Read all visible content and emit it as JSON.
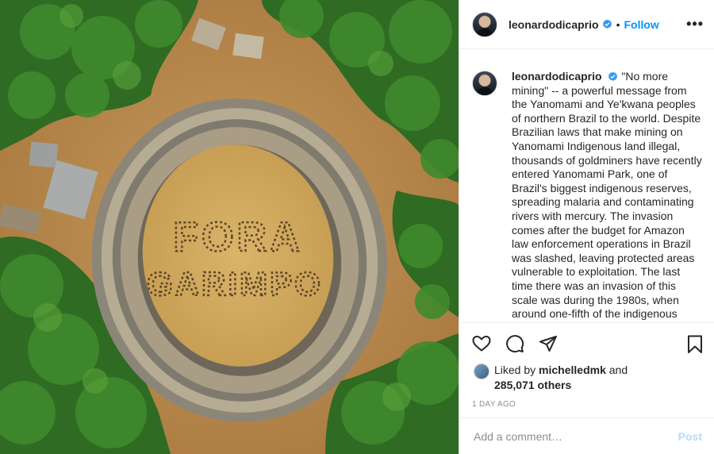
{
  "post": {
    "username": "leonardodicaprio",
    "follow_label": "Follow",
    "more_label": "•••",
    "separator": "•",
    "caption_username": "leonardodicaprio",
    "caption_text": "\"No more mining\" -- a powerful message from the Yanomami and Ye'kwana peoples of northern Brazil to the world. Despite Brazilian laws that make mining on Yanomami Indigenous land illegal, thousands of goldminers have recently entered Yanomami Park, one of Brazil's biggest indigenous reserves, spreading malaria and contaminating rivers with mercury. The invasion comes after the budget for Amazon law enforcement operations in Brazil was slashed, leaving protected areas vulnerable to exploitation. The last time there was an invasion of this scale was during the 1980s, when around one-fifth of the indigenous population died from",
    "liked_prefix": "Liked by",
    "liked_user": "michelledmk",
    "liked_and": "and",
    "liked_count": "285,071 others",
    "timestamp": "1 DAY AGO",
    "verified_icon": "verified-badge-icon",
    "verified_color": "#3897f0"
  },
  "photo": {
    "text_line1": "FORA",
    "text_line2": "GARIMPO"
  },
  "comment": {
    "placeholder": "Add a comment…",
    "post_label": "Post",
    "post_color": "#b2dffc"
  },
  "icons": {
    "like": "heart-icon",
    "comment": "comment-icon",
    "share": "paper-plane-icon",
    "save": "bookmark-icon"
  },
  "colors": {
    "link_blue": "#0095f6",
    "muted": "#8e8e8e",
    "text": "#262626"
  }
}
